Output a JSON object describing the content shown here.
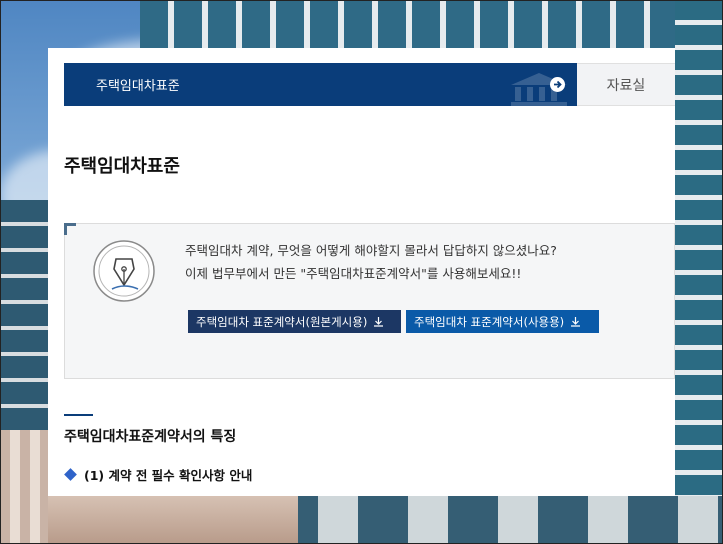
{
  "header": {
    "title": "주택임대차표준",
    "side_menu": "자료실"
  },
  "page": {
    "title": "주택임대차표준"
  },
  "info": {
    "line1": "주택임대차 계약, 무엇을 어떻게 해야할지 몰라서 답답하지 않으셨나요?",
    "line2": "이제 법무부에서 만든 \"주택임대차표준계약서\"를 사용해보세요!!",
    "buttons": [
      {
        "label": "주택임대차 표준계약서(원본게시용)"
      },
      {
        "label": "주택임대차 표준계약서(사용용)"
      }
    ]
  },
  "section": {
    "title": "주택임대차표준계약서의 특징",
    "item1": "(1) 계약 전 필수 확인사항 안내"
  },
  "colors": {
    "header_bg": "#0a3d7a",
    "button_dark": "#1c3764",
    "button_blue": "#0a5aa8",
    "bullet": "#2f63c9"
  },
  "icons": [
    "arrow-right-icon",
    "building-icon",
    "pen-nib-icon",
    "download-icon",
    "diamond-bullet-icon"
  ]
}
